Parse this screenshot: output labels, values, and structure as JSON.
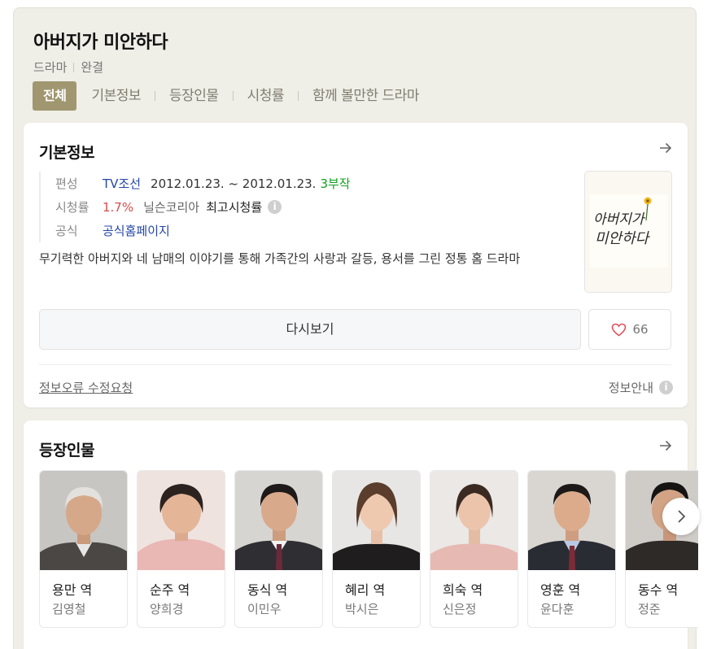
{
  "header": {
    "title": "아버지가 미안하다",
    "genre": "드라마",
    "status": "완결"
  },
  "tabs": [
    {
      "label": "전체",
      "active": true
    },
    {
      "label": "기본정보"
    },
    {
      "label": "등장인물"
    },
    {
      "label": "시청률"
    },
    {
      "label": "함께 볼만한 드라마"
    }
  ],
  "basic_info": {
    "heading": "기본정보",
    "broadcast": {
      "label": "편성",
      "channel": "TV조선",
      "dates": "2012.01.23. ~ 2012.01.23.",
      "episodes": "3부작"
    },
    "rating": {
      "label": "시청률",
      "value": "1.7%",
      "source": "닐슨코리아",
      "note": "최고시청률"
    },
    "official": {
      "label": "공식",
      "link_text": "공식홈페이지"
    },
    "description": "무기력한 아버지와 네 남매의 이야기를 통해 가족간의 사랑과 갈등, 용서를 그린 정통 홈 드라마",
    "poster_alt": "아버지가 미안하다",
    "rewatch_label": "다시보기",
    "like_count": "66",
    "correction_label": "정보오류 수정요청",
    "guide_label": "정보안내"
  },
  "cast": {
    "heading": "등장인물",
    "members": [
      {
        "role": "용만 역",
        "actor": "김영철"
      },
      {
        "role": "순주 역",
        "actor": "양희경"
      },
      {
        "role": "동식 역",
        "actor": "이민우"
      },
      {
        "role": "혜리 역",
        "actor": "박시은"
      },
      {
        "role": "희숙 역",
        "actor": "신은정"
      },
      {
        "role": "영훈 역",
        "actor": "윤다훈"
      },
      {
        "role": "동수 역",
        "actor": "정준"
      }
    ]
  },
  "colors": {
    "accent": "#a09770",
    "link": "#2446a8",
    "rating": "#d94c4c",
    "episodes": "#12a020",
    "like": "#e0505a"
  }
}
